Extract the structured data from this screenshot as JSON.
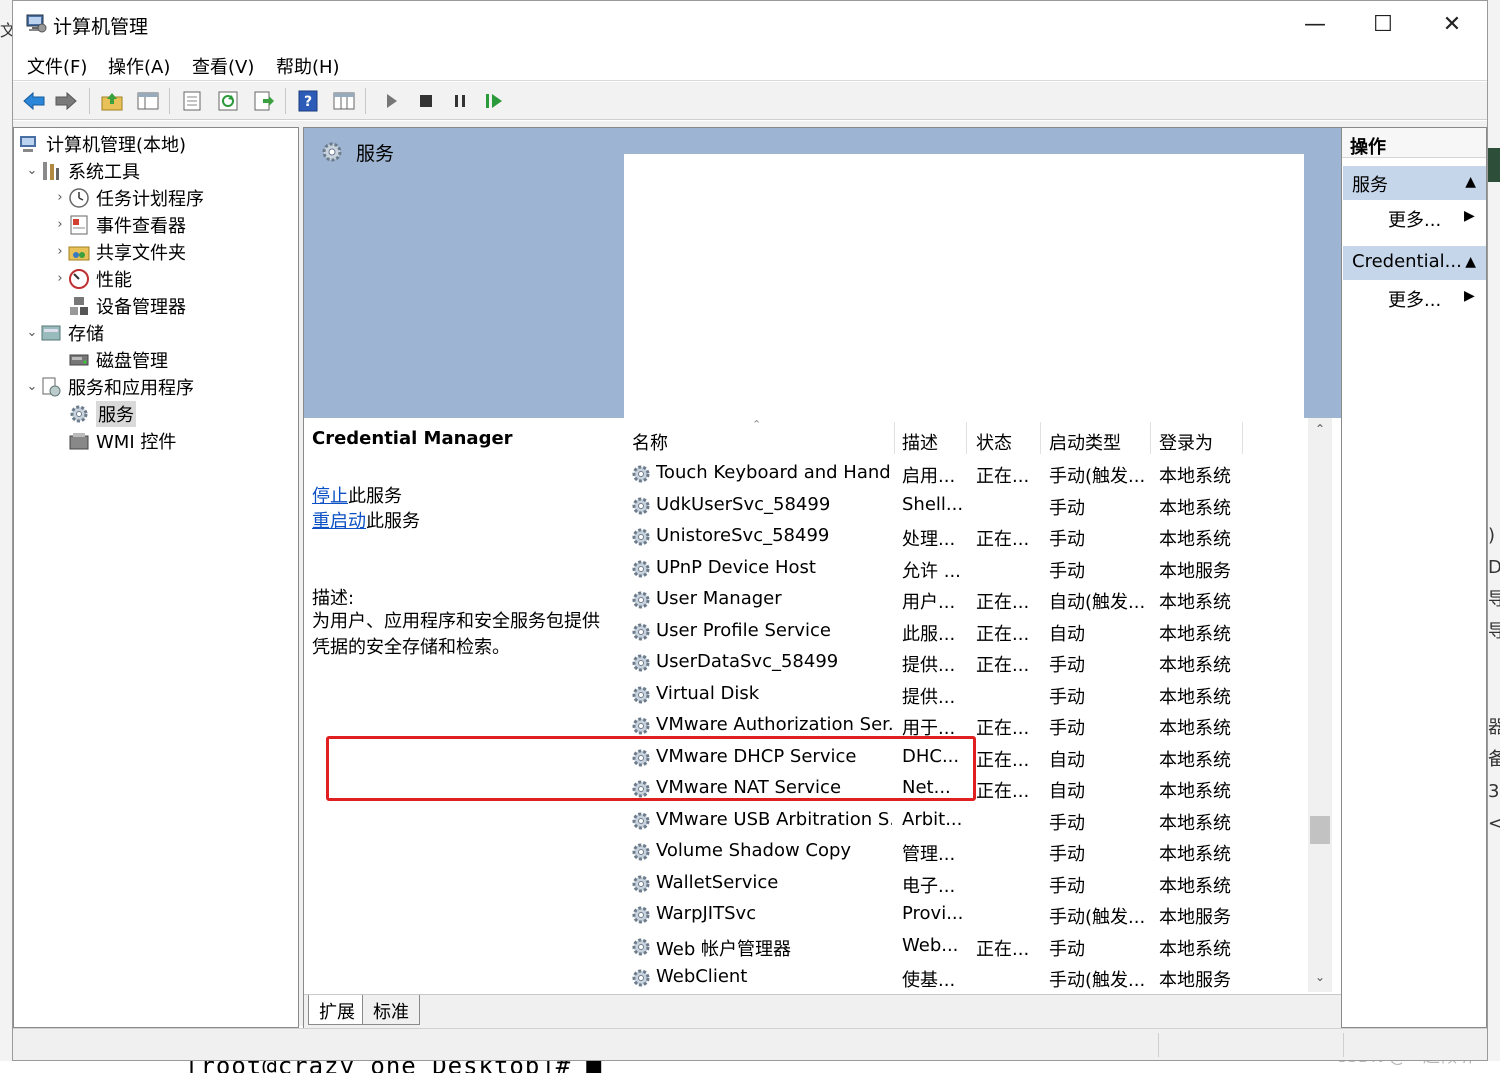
{
  "window": {
    "title": "计算机管理",
    "controls": {
      "minimize": "—",
      "maximize": "☐",
      "close": "✕"
    }
  },
  "menu": [
    "文件(F)",
    "操作(A)",
    "查看(V)",
    "帮助(H)"
  ],
  "toolbar": [
    "back-icon",
    "forward-icon",
    "up-folder-icon",
    "show-tree-icon",
    "properties-icon",
    "refresh-icon",
    "export-icon",
    "help-icon",
    "view-icon",
    "play-icon",
    "stop-icon",
    "pause-icon",
    "resume-icon"
  ],
  "tree": [
    {
      "label": "计算机管理(本地)",
      "level": 0,
      "exp": "",
      "icon": "computer-icon"
    },
    {
      "label": "系统工具",
      "level": 1,
      "exp": "⌄",
      "icon": "tools-icon"
    },
    {
      "label": "任务计划程序",
      "level": 2,
      "exp": "›",
      "icon": "clock-icon"
    },
    {
      "label": "事件查看器",
      "level": 2,
      "exp": "›",
      "icon": "event-viewer-icon"
    },
    {
      "label": "共享文件夹",
      "level": 2,
      "exp": "›",
      "icon": "shared-folder-icon"
    },
    {
      "label": "性能",
      "level": 2,
      "exp": "›",
      "icon": "performance-icon"
    },
    {
      "label": "设备管理器",
      "level": 2,
      "exp": "",
      "icon": "device-manager-icon"
    },
    {
      "label": "存储",
      "level": 1,
      "exp": "⌄",
      "icon": "storage-icon"
    },
    {
      "label": "磁盘管理",
      "level": 2,
      "exp": "",
      "icon": "disk-icon"
    },
    {
      "label": "服务和应用程序",
      "level": 1,
      "exp": "⌄",
      "icon": "services-apps-icon"
    },
    {
      "label": "服务",
      "level": 2,
      "exp": "",
      "icon": "gear-icon",
      "selected": true
    },
    {
      "label": "WMI 控件",
      "level": 2,
      "exp": "",
      "icon": "wmi-icon"
    }
  ],
  "center": {
    "header_title": "服务",
    "selected_service": "Credential Manager",
    "stop_link": "停止",
    "stop_suffix": "此服务",
    "restart_link": "重启动",
    "restart_suffix": "此服务",
    "desc_label": "描述:",
    "desc_text": "为用户、应用程序和安全服务包提供凭据的安全存储和检索。"
  },
  "columns": [
    "名称",
    "描述",
    "状态",
    "启动类型",
    "登录为"
  ],
  "services": [
    {
      "name": "Touch Keyboard and Hand...",
      "desc": "启用...",
      "status": "正在...",
      "start": "手动(触发...",
      "logon": "本地系统"
    },
    {
      "name": "UdkUserSvc_58499",
      "desc": "Shell...",
      "status": "",
      "start": "手动",
      "logon": "本地系统"
    },
    {
      "name": "UnistoreSvc_58499",
      "desc": "处理...",
      "status": "正在...",
      "start": "手动",
      "logon": "本地系统"
    },
    {
      "name": "UPnP Device Host",
      "desc": "允许 ...",
      "status": "",
      "start": "手动",
      "logon": "本地服务"
    },
    {
      "name": "User Manager",
      "desc": "用户...",
      "status": "正在...",
      "start": "自动(触发...",
      "logon": "本地系统"
    },
    {
      "name": "User Profile Service",
      "desc": "此服...",
      "status": "正在...",
      "start": "自动",
      "logon": "本地系统"
    },
    {
      "name": "UserDataSvc_58499",
      "desc": "提供...",
      "status": "正在...",
      "start": "手动",
      "logon": "本地系统"
    },
    {
      "name": "Virtual Disk",
      "desc": "提供...",
      "status": "",
      "start": "手动",
      "logon": "本地系统"
    },
    {
      "name": "VMware Authorization Ser...",
      "desc": "用于...",
      "status": "正在...",
      "start": "手动",
      "logon": "本地系统"
    },
    {
      "name": "VMware DHCP Service",
      "desc": "DHC...",
      "status": "正在...",
      "start": "自动",
      "logon": "本地系统"
    },
    {
      "name": "VMware NAT Service",
      "desc": "Net...",
      "status": "正在...",
      "start": "自动",
      "logon": "本地系统"
    },
    {
      "name": "VMware USB Arbitration S...",
      "desc": "Arbit...",
      "status": "",
      "start": "手动",
      "logon": "本地系统"
    },
    {
      "name": "Volume Shadow Copy",
      "desc": "管理...",
      "status": "",
      "start": "手动",
      "logon": "本地系统"
    },
    {
      "name": "WalletService",
      "desc": "电子...",
      "status": "",
      "start": "手动",
      "logon": "本地系统"
    },
    {
      "name": "WarpJITSvc",
      "desc": "Provi...",
      "status": "",
      "start": "手动(触发...",
      "logon": "本地服务"
    },
    {
      "name": "Web 帐户管理器",
      "desc": "Web...",
      "status": "正在...",
      "start": "手动",
      "logon": "本地系统"
    },
    {
      "name": "WebClient",
      "desc": "使基...",
      "status": "",
      "start": "手动(触发...",
      "logon": "本地服务"
    }
  ],
  "tabs": [
    "扩展",
    "标准"
  ],
  "actions": {
    "title": "操作",
    "sections": [
      {
        "label": "服务",
        "more": "更多..."
      },
      {
        "label": "Credential...",
        "more": "更多..."
      }
    ]
  },
  "background": {
    "terminal_text": "[root@crazy_one Desktop]# █",
    "watermark": "CSDN @一起倾听",
    "left_glyphs": "文\n\n\n\n\n\n",
    "right_glyphs": ")\nD\n导\n导\n\n\n器\n备\n3)\n<)\n"
  },
  "colors": {
    "header_blue": "#9db5d3",
    "action_section": "#c6d6ea",
    "link": "#0b50c4",
    "highlight": "#e02020"
  }
}
